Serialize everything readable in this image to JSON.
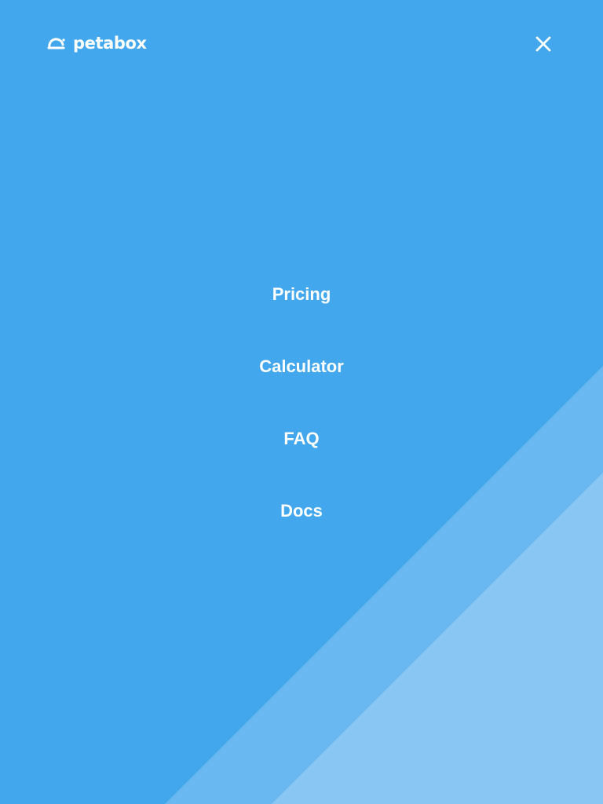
{
  "brand": {
    "name": "petabox",
    "icon": "cloud-icon"
  },
  "header": {
    "close_icon": "close-icon"
  },
  "nav": {
    "items": [
      {
        "label": "Pricing"
      },
      {
        "label": "Calculator"
      },
      {
        "label": "FAQ"
      },
      {
        "label": "Docs"
      }
    ]
  },
  "colors": {
    "background": "#42a7ed",
    "stripe_mid": "#69b8f2",
    "stripe_light": "#89c6f4",
    "text": "#ffffff"
  }
}
